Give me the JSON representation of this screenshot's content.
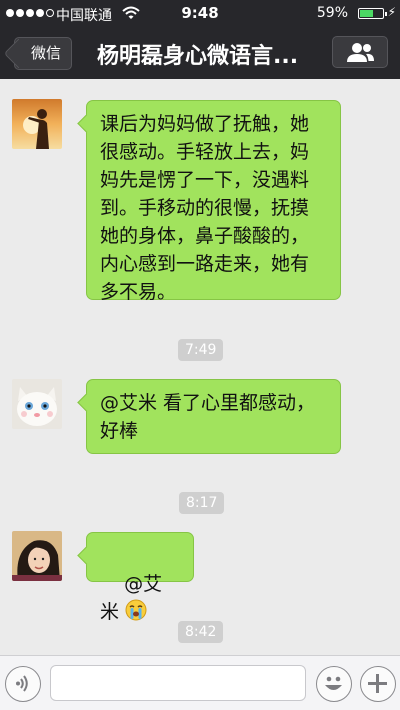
{
  "status_bar": {
    "carrier": "中国联通",
    "time": "9:48",
    "battery_percent": "59%",
    "battery_level": 0.59,
    "signal_bars_filled": 4,
    "signal_bars_total": 5
  },
  "nav": {
    "back_label": "微信",
    "title": "杨明磊身心微语言...",
    "members_icon": "group-members-icon"
  },
  "messages": [
    {
      "avatar": "avatar-silhouette-sunset",
      "text": "课后为妈妈做了抚触，她\n很感动。手轻放上去，妈\n妈先是愣了一下，没遇料\n到。手移动的很慢，抚摸\n她的身体，鼻子酸酸的，\n内心感到一路走来，她有\n多不易。"
    },
    {
      "timestamp": "7:49"
    },
    {
      "avatar": "avatar-white-cat",
      "text": "@艾米 看了心里都感动，\n好棒"
    },
    {
      "timestamp": "8:17"
    },
    {
      "avatar": "avatar-woman-photo",
      "text": "@艾米 ",
      "emoji": "crying-face-icon"
    },
    {
      "timestamp": "8:42"
    }
  ],
  "input_bar": {
    "voice_icon": "voice-icon",
    "emoji_icon": "smiley-icon",
    "more_icon": "plus-icon",
    "input_value": ""
  },
  "colors": {
    "nav_background": "#27272b",
    "chat_background": "#ebebeb",
    "bubble_fill": "#a1e35d",
    "battery_fill": "#4cd964"
  }
}
